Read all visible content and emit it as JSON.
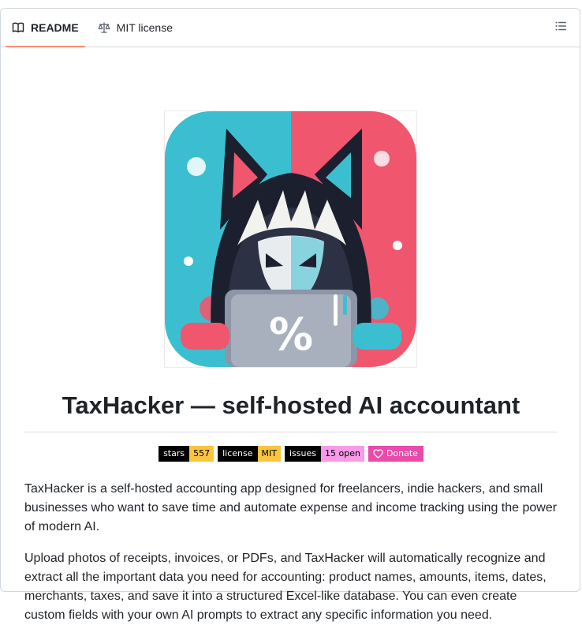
{
  "tabs": [
    {
      "label": "README",
      "icon": "book-icon",
      "active": true
    },
    {
      "label": "MIT license",
      "icon": "scale-icon",
      "active": false
    }
  ],
  "toolbar": {
    "outline_icon": "list-unordered-icon"
  },
  "readme": {
    "title": "TaxHacker — self-hosted AI accountant",
    "badges": [
      {
        "key": "stars",
        "value": "557",
        "color": "#fbc43f"
      },
      {
        "key": "license",
        "value": "MIT",
        "color": "#fbc43f"
      },
      {
        "key": "issues",
        "value": "15 open",
        "color": "#f79ae8"
      }
    ],
    "donate": {
      "label": "Donate",
      "icon": "heart-icon",
      "color": "#ea4aaa"
    },
    "paragraphs": [
      "TaxHacker is a self-hosted accounting app designed for freelancers, indie hackers, and small businesses who want to save time and automate expense and income tracking using the power of modern AI.",
      "Upload photos of receipts, invoices, or PDFs, and TaxHacker will automatically recognize and extract all the important data you need for accounting: product names, amounts, items, dates, merchants, taxes, and save it into a structured Excel-like database. You can even create custom fields with your own AI prompts to extract any specific information you need."
    ]
  },
  "colors": {
    "accent_underline": "#fd8c73",
    "logo_cyan": "#3bbfd0",
    "logo_pink": "#f0566e",
    "logo_dark": "#1c1f2e"
  }
}
